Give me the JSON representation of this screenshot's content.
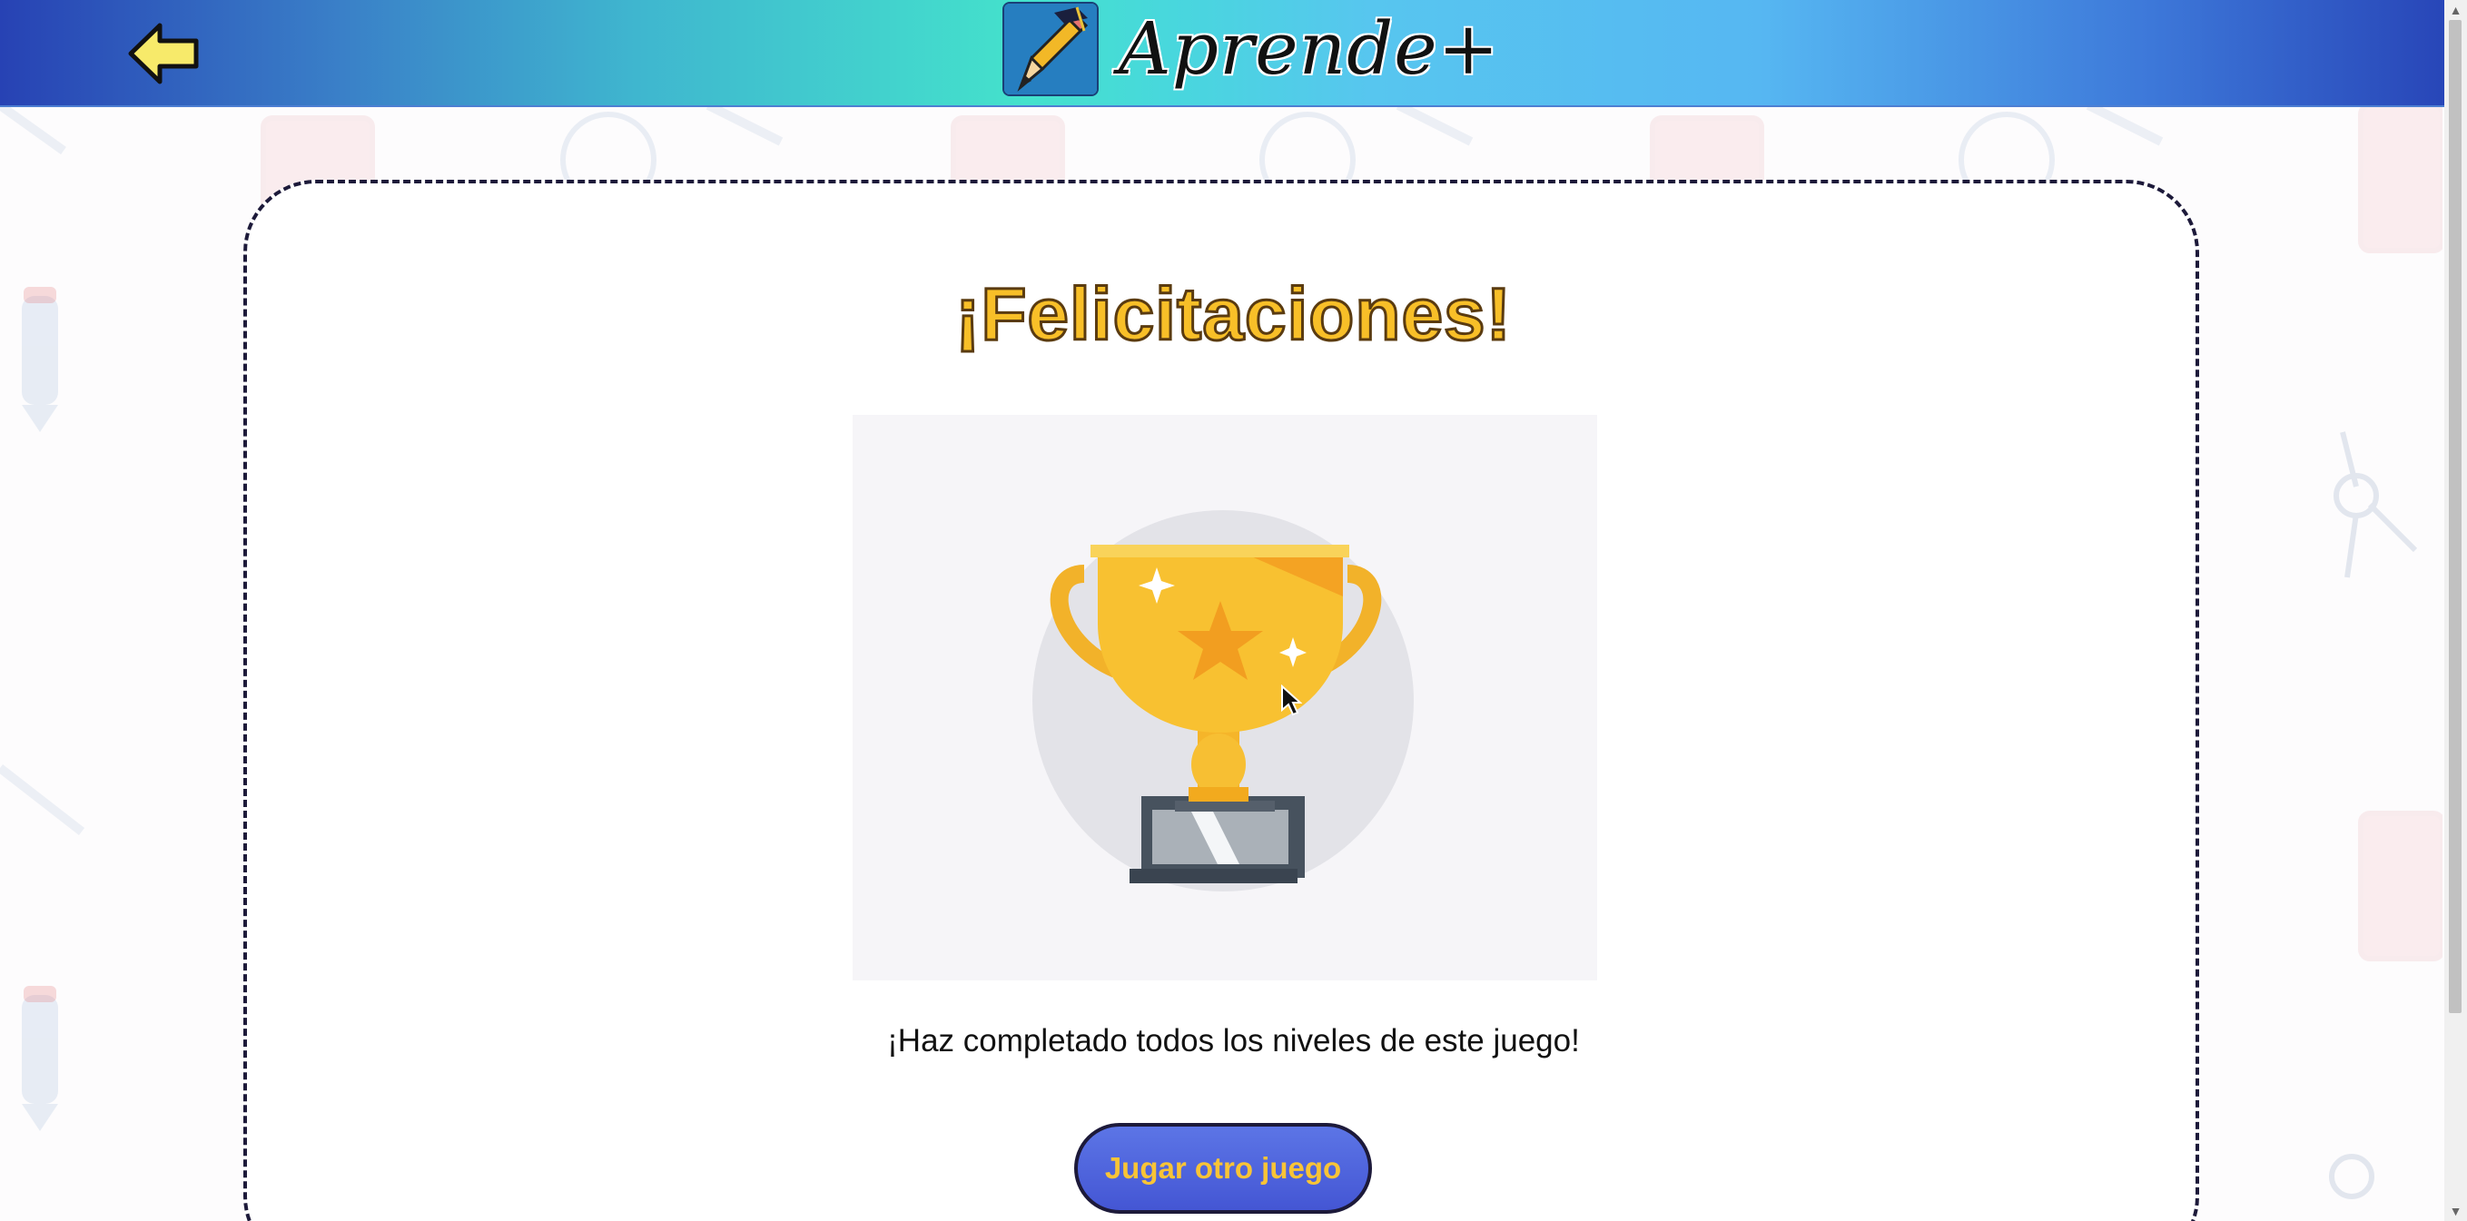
{
  "header": {
    "brand_name": "Aprende+",
    "back_icon": "arrow-left-icon",
    "logo_icon": "pencil-logo-icon"
  },
  "main": {
    "title": "¡Felicitaciones!",
    "image": "trophy-icon",
    "message": "¡Haz completado todos los niveles de este juego!",
    "button_label": "Jugar otro juego"
  },
  "colors": {
    "title": "#f8bf28",
    "button_bg": "#4f63dc",
    "button_text": "#f9c436",
    "back_arrow": "#f7ea6a"
  }
}
